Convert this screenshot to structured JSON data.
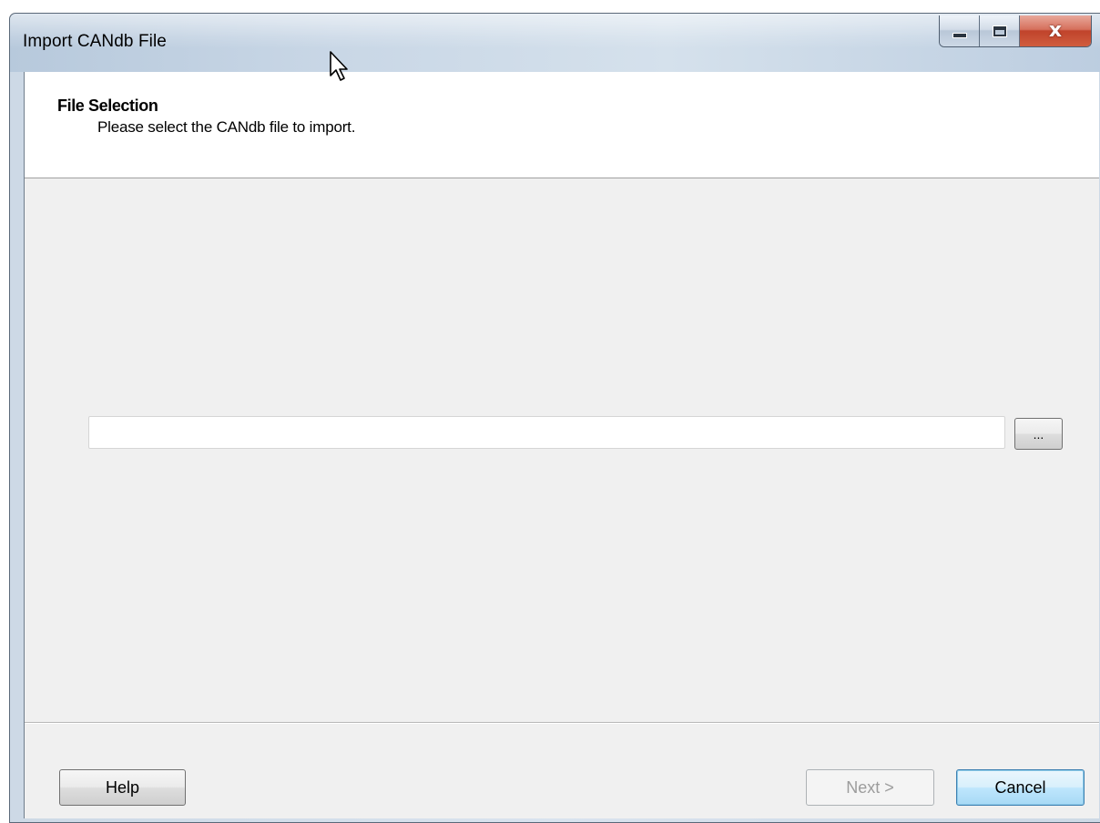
{
  "window": {
    "title": "Import CANdb File",
    "close_glyph": "x",
    "icons": {
      "minimize": "minimize-icon",
      "maximize": "maximize-icon",
      "close": "close-icon",
      "cursor": "mouse-pointer-icon"
    },
    "close_color": "#c0432b"
  },
  "header": {
    "title": "File Selection",
    "subtitle": "Please select the CANdb file to import."
  },
  "file": {
    "value": "",
    "browse_label": "..."
  },
  "footer": {
    "help_label": "Help",
    "next_label": "Next >",
    "cancel_label": "Cancel"
  }
}
